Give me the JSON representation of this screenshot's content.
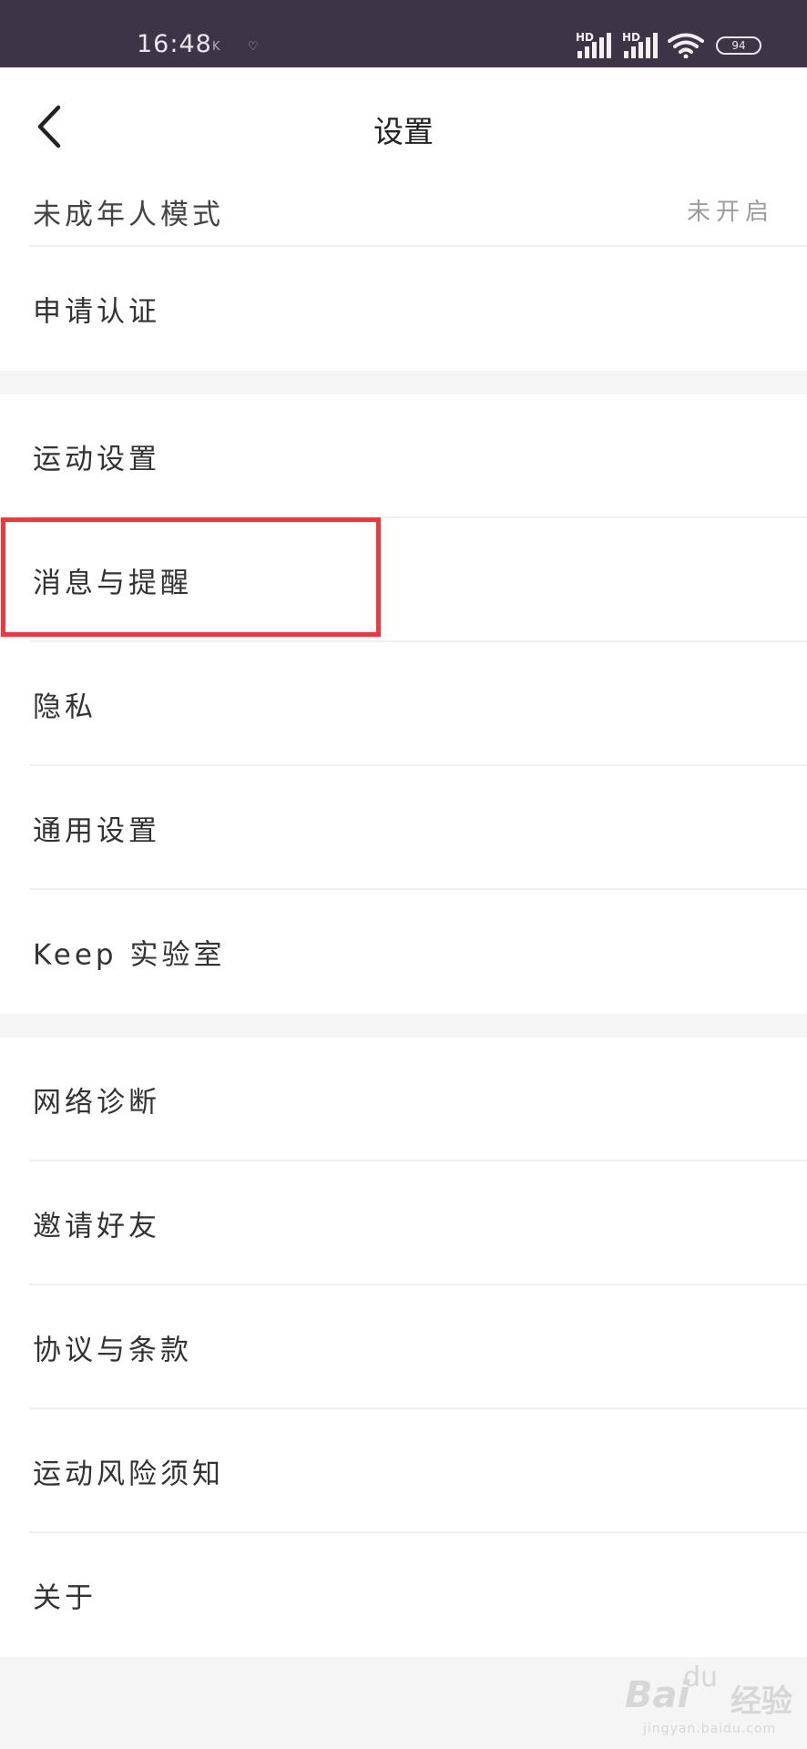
{
  "status_bar": {
    "time": "16:48",
    "indicator_1": "K",
    "indicator_2": "♡",
    "signal_1_label": "HD",
    "signal_2_label": "HD",
    "battery": "94"
  },
  "navbar": {
    "title": "设置"
  },
  "group1": [
    {
      "label": "未成年人模式",
      "value": "未开启"
    },
    {
      "label": "申请认证"
    }
  ],
  "group2": [
    {
      "label": "运动设置"
    },
    {
      "label": "消息与提醒"
    },
    {
      "label": "隐私"
    },
    {
      "label": "通用设置"
    },
    {
      "label": "Keep 实验室"
    }
  ],
  "group3": [
    {
      "label": "网络诊断"
    },
    {
      "label": "邀请好友"
    },
    {
      "label": "协议与条款"
    },
    {
      "label": "运动风险须知"
    },
    {
      "label": "关于"
    }
  ],
  "watermark": {
    "brand": "Bai",
    "brand_paw": "du",
    "cn": "经验",
    "url": "jingyan.baidu.com"
  },
  "colors": {
    "status_bar_bg": "#3d3545",
    "highlight_border": "#f0373d",
    "page_bg": "#f5f5f5"
  }
}
